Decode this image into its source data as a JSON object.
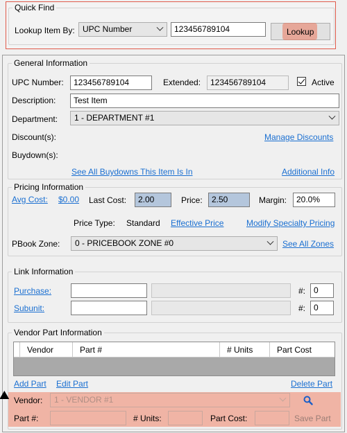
{
  "quick_find": {
    "title": "Quick Find",
    "lookup_label": "Lookup Item By:",
    "lookup_by_value": "UPC Number",
    "lookup_value": "123456789104",
    "lookup_button": "Lookup"
  },
  "general": {
    "title": "General Information",
    "upc_label": "UPC Number:",
    "upc_value": "123456789104",
    "extended_label": "Extended:",
    "extended_value": "123456789104",
    "active_label": "Active",
    "active_checked": true,
    "description_label": "Description:",
    "description_value": "Test Item",
    "department_label": "Department:",
    "department_value": "1 - DEPARTMENT #1",
    "discounts_label": "Discount(s):",
    "manage_discounts": "Manage Discounts",
    "buydowns_label": "Buydown(s):",
    "see_buydowns": "See All Buydowns This Item Is In",
    "additional_info": "Additional Info"
  },
  "pricing": {
    "title": "Pricing Information",
    "avg_cost_label": "Avg Cost:",
    "avg_cost_value": "$0.00",
    "last_cost_label": "Last Cost:",
    "last_cost_value": "2.00",
    "price_label": "Price:",
    "price_value": "2.50",
    "margin_label": "Margin:",
    "margin_value": "20.0%",
    "price_type_label": "Price Type:",
    "price_type_value": "Standard",
    "effective_price": "Effective Price",
    "modify_specialty": "Modify Specialty Pricing",
    "pbook_label": "PBook Zone:",
    "pbook_value": "0 - PRICEBOOK ZONE #0",
    "see_all_zones": "See All Zones"
  },
  "link": {
    "title": "Link Information",
    "purchase_label": "Purchase:",
    "subunit_label": "Subunit:",
    "hash_label": "#:",
    "purchase_qty": "0",
    "subunit_qty": "0"
  },
  "vendor": {
    "title": "Vendor Part Information",
    "columns": [
      "Vendor",
      "Part #",
      "# Units",
      "Part Cost"
    ],
    "add_part": "Add Part",
    "edit_part": "Edit Part",
    "delete_part": "Delete Part",
    "vendor_label": "Vendor:",
    "vendor_value": "1 - VENDOR #1",
    "part_label": "Part #:",
    "units_label": "# Units:",
    "part_cost_label": "Part Cost:",
    "save_part": "Save Part"
  },
  "colors": {
    "highlight": "#eb785f",
    "link": "#1a6fd1",
    "selection": "#b4c6dc"
  }
}
